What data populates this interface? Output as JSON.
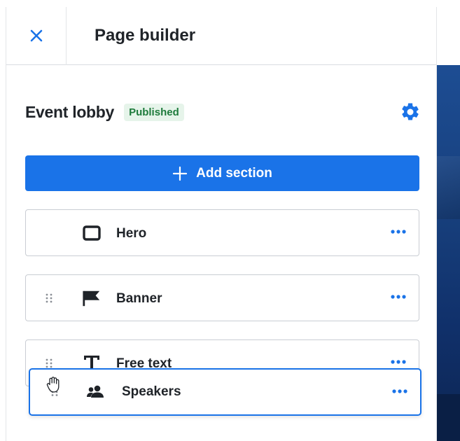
{
  "header": {
    "title": "Page builder",
    "close_icon": "close-icon"
  },
  "page": {
    "name": "Event lobby",
    "status": "Published",
    "settings_icon": "gear-icon"
  },
  "add_section": {
    "label": "Add section",
    "icon": "plus-icon"
  },
  "sections": [
    {
      "label": "Hero",
      "icon": "rectangle-icon",
      "draggable": false
    },
    {
      "label": "Banner",
      "icon": "flag-icon",
      "draggable": true
    },
    {
      "label": "Free text",
      "icon": "text-icon",
      "draggable": true
    }
  ],
  "dragging_section": {
    "label": "Speakers",
    "icon": "speakers-icon"
  },
  "colors": {
    "accent": "#1a73e8",
    "status_bg": "#e6f4ea",
    "status_text": "#1e7b3c",
    "preview": "#173f7c"
  }
}
